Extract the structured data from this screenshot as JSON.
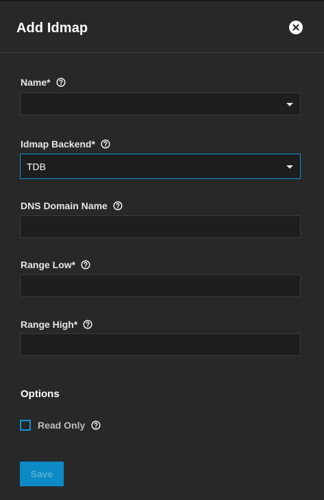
{
  "dialog": {
    "title": "Add Idmap"
  },
  "fields": {
    "name": {
      "label": "Name",
      "required_marker": "*",
      "value": ""
    },
    "backend": {
      "label": "Idmap Backend",
      "required_marker": "*",
      "value": "TDB"
    },
    "dns_domain": {
      "label": "DNS Domain Name",
      "value": ""
    },
    "range_low": {
      "label": "Range Low",
      "required_marker": "*",
      "value": ""
    },
    "range_high": {
      "label": "Range High",
      "required_marker": "*",
      "value": ""
    }
  },
  "options": {
    "title": "Options",
    "read_only_label": "Read Only",
    "read_only_checked": false
  },
  "actions": {
    "save_label": "Save"
  },
  "colors": {
    "accent": "#0a95d8",
    "background": "#282828",
    "input_background": "#1e1e1e"
  },
  "icons": {
    "close": "close-icon",
    "help": "help-circle-icon",
    "dropdown": "caret-down-icon"
  }
}
